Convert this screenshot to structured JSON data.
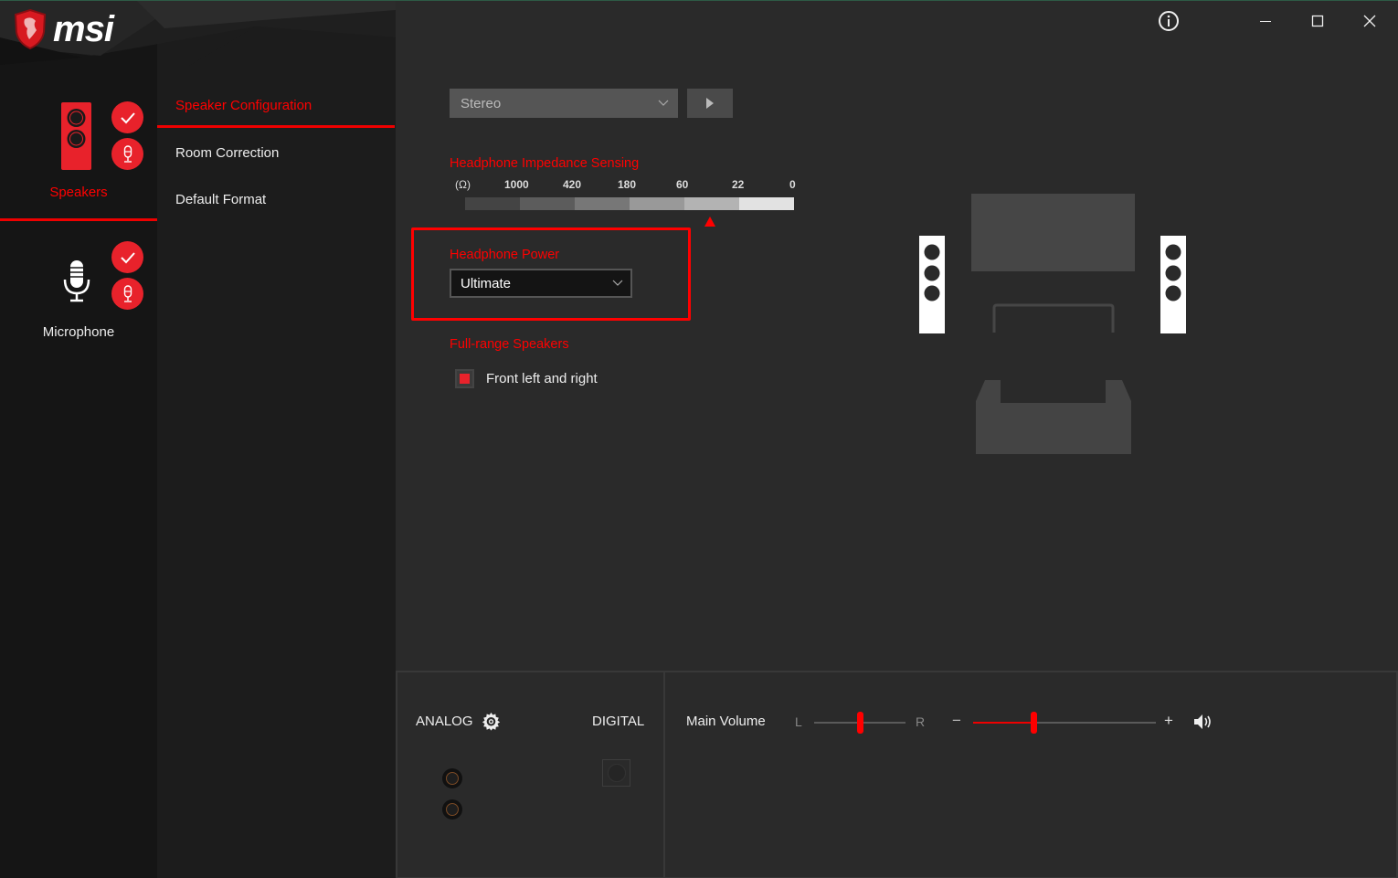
{
  "app": {
    "brand": "msi",
    "window_controls": {
      "info": "info-icon",
      "minimize": "minimize-icon",
      "maximize": "maximize-icon",
      "close": "close-icon"
    }
  },
  "sidebar": {
    "devices": [
      {
        "label": "Speakers",
        "active": true,
        "badges": [
          "check-icon",
          "mic-icon"
        ]
      },
      {
        "label": "Microphone",
        "active": false,
        "badges": [
          "check-icon",
          "mic-icon"
        ]
      }
    ]
  },
  "subnav": {
    "items": [
      {
        "label": "Speaker Configuration",
        "active": true
      },
      {
        "label": "Room Correction",
        "active": false
      },
      {
        "label": "Default Format",
        "active": false
      }
    ]
  },
  "main": {
    "speaker_config": {
      "selected": "Stereo",
      "play_button": "play-icon"
    },
    "impedance": {
      "title": "Headphone Impedance Sensing",
      "unit": "(Ω)",
      "ticks": [
        "1000",
        "420",
        "180",
        "60",
        "22",
        "0"
      ],
      "indicator_between": [
        "60",
        "22"
      ]
    },
    "headphone_power": {
      "title": "Headphone Power",
      "selected": "Ultimate"
    },
    "full_range": {
      "title": "Full-range Speakers",
      "checkbox_label": "Front left and right",
      "checked": true
    }
  },
  "bottom": {
    "analog_label": "ANALOG",
    "digital_label": "DIGITAL",
    "main_volume_label": "Main Volume",
    "balance": {
      "left": "L",
      "right": "R",
      "value_fraction": 0.5
    },
    "volume": {
      "minus": "−",
      "plus": "+",
      "value_fraction": 0.33
    }
  },
  "colors": {
    "accent": "#ff0000",
    "badge": "#e8222b",
    "bg": "#2a2a2a",
    "sidebar": "#151515"
  }
}
